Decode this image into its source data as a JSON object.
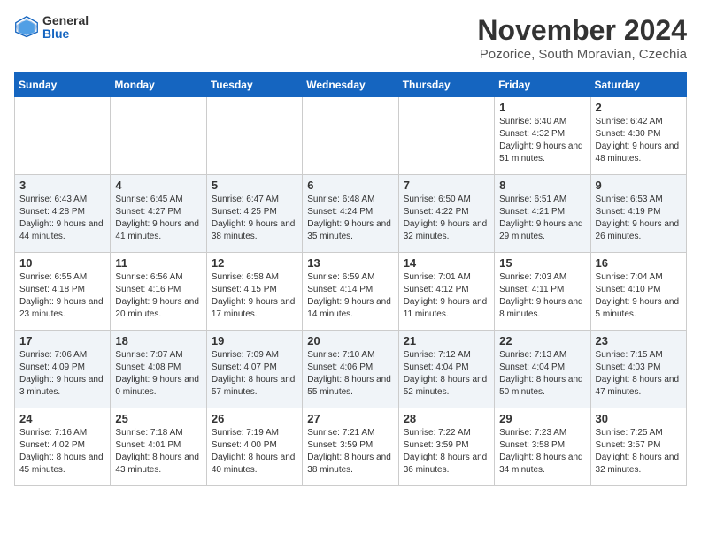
{
  "logo": {
    "general": "General",
    "blue": "Blue"
  },
  "title": "November 2024",
  "subtitle": "Pozorice, South Moravian, Czechia",
  "days_header": [
    "Sunday",
    "Monday",
    "Tuesday",
    "Wednesday",
    "Thursday",
    "Friday",
    "Saturday"
  ],
  "weeks": [
    [
      {
        "day": "",
        "info": ""
      },
      {
        "day": "",
        "info": ""
      },
      {
        "day": "",
        "info": ""
      },
      {
        "day": "",
        "info": ""
      },
      {
        "day": "",
        "info": ""
      },
      {
        "day": "1",
        "info": "Sunrise: 6:40 AM\nSunset: 4:32 PM\nDaylight: 9 hours\nand 51 minutes."
      },
      {
        "day": "2",
        "info": "Sunrise: 6:42 AM\nSunset: 4:30 PM\nDaylight: 9 hours\nand 48 minutes."
      }
    ],
    [
      {
        "day": "3",
        "info": "Sunrise: 6:43 AM\nSunset: 4:28 PM\nDaylight: 9 hours\nand 44 minutes."
      },
      {
        "day": "4",
        "info": "Sunrise: 6:45 AM\nSunset: 4:27 PM\nDaylight: 9 hours\nand 41 minutes."
      },
      {
        "day": "5",
        "info": "Sunrise: 6:47 AM\nSunset: 4:25 PM\nDaylight: 9 hours\nand 38 minutes."
      },
      {
        "day": "6",
        "info": "Sunrise: 6:48 AM\nSunset: 4:24 PM\nDaylight: 9 hours\nand 35 minutes."
      },
      {
        "day": "7",
        "info": "Sunrise: 6:50 AM\nSunset: 4:22 PM\nDaylight: 9 hours\nand 32 minutes."
      },
      {
        "day": "8",
        "info": "Sunrise: 6:51 AM\nSunset: 4:21 PM\nDaylight: 9 hours\nand 29 minutes."
      },
      {
        "day": "9",
        "info": "Sunrise: 6:53 AM\nSunset: 4:19 PM\nDaylight: 9 hours\nand 26 minutes."
      }
    ],
    [
      {
        "day": "10",
        "info": "Sunrise: 6:55 AM\nSunset: 4:18 PM\nDaylight: 9 hours\nand 23 minutes."
      },
      {
        "day": "11",
        "info": "Sunrise: 6:56 AM\nSunset: 4:16 PM\nDaylight: 9 hours\nand 20 minutes."
      },
      {
        "day": "12",
        "info": "Sunrise: 6:58 AM\nSunset: 4:15 PM\nDaylight: 9 hours\nand 17 minutes."
      },
      {
        "day": "13",
        "info": "Sunrise: 6:59 AM\nSunset: 4:14 PM\nDaylight: 9 hours\nand 14 minutes."
      },
      {
        "day": "14",
        "info": "Sunrise: 7:01 AM\nSunset: 4:12 PM\nDaylight: 9 hours\nand 11 minutes."
      },
      {
        "day": "15",
        "info": "Sunrise: 7:03 AM\nSunset: 4:11 PM\nDaylight: 9 hours\nand 8 minutes."
      },
      {
        "day": "16",
        "info": "Sunrise: 7:04 AM\nSunset: 4:10 PM\nDaylight: 9 hours\nand 5 minutes."
      }
    ],
    [
      {
        "day": "17",
        "info": "Sunrise: 7:06 AM\nSunset: 4:09 PM\nDaylight: 9 hours\nand 3 minutes."
      },
      {
        "day": "18",
        "info": "Sunrise: 7:07 AM\nSunset: 4:08 PM\nDaylight: 9 hours\nand 0 minutes."
      },
      {
        "day": "19",
        "info": "Sunrise: 7:09 AM\nSunset: 4:07 PM\nDaylight: 8 hours\nand 57 minutes."
      },
      {
        "day": "20",
        "info": "Sunrise: 7:10 AM\nSunset: 4:06 PM\nDaylight: 8 hours\nand 55 minutes."
      },
      {
        "day": "21",
        "info": "Sunrise: 7:12 AM\nSunset: 4:04 PM\nDaylight: 8 hours\nand 52 minutes."
      },
      {
        "day": "22",
        "info": "Sunrise: 7:13 AM\nSunset: 4:04 PM\nDaylight: 8 hours\nand 50 minutes."
      },
      {
        "day": "23",
        "info": "Sunrise: 7:15 AM\nSunset: 4:03 PM\nDaylight: 8 hours\nand 47 minutes."
      }
    ],
    [
      {
        "day": "24",
        "info": "Sunrise: 7:16 AM\nSunset: 4:02 PM\nDaylight: 8 hours\nand 45 minutes."
      },
      {
        "day": "25",
        "info": "Sunrise: 7:18 AM\nSunset: 4:01 PM\nDaylight: 8 hours\nand 43 minutes."
      },
      {
        "day": "26",
        "info": "Sunrise: 7:19 AM\nSunset: 4:00 PM\nDaylight: 8 hours\nand 40 minutes."
      },
      {
        "day": "27",
        "info": "Sunrise: 7:21 AM\nSunset: 3:59 PM\nDaylight: 8 hours\nand 38 minutes."
      },
      {
        "day": "28",
        "info": "Sunrise: 7:22 AM\nSunset: 3:59 PM\nDaylight: 8 hours\nand 36 minutes."
      },
      {
        "day": "29",
        "info": "Sunrise: 7:23 AM\nSunset: 3:58 PM\nDaylight: 8 hours\nand 34 minutes."
      },
      {
        "day": "30",
        "info": "Sunrise: 7:25 AM\nSunset: 3:57 PM\nDaylight: 8 hours\nand 32 minutes."
      }
    ]
  ]
}
